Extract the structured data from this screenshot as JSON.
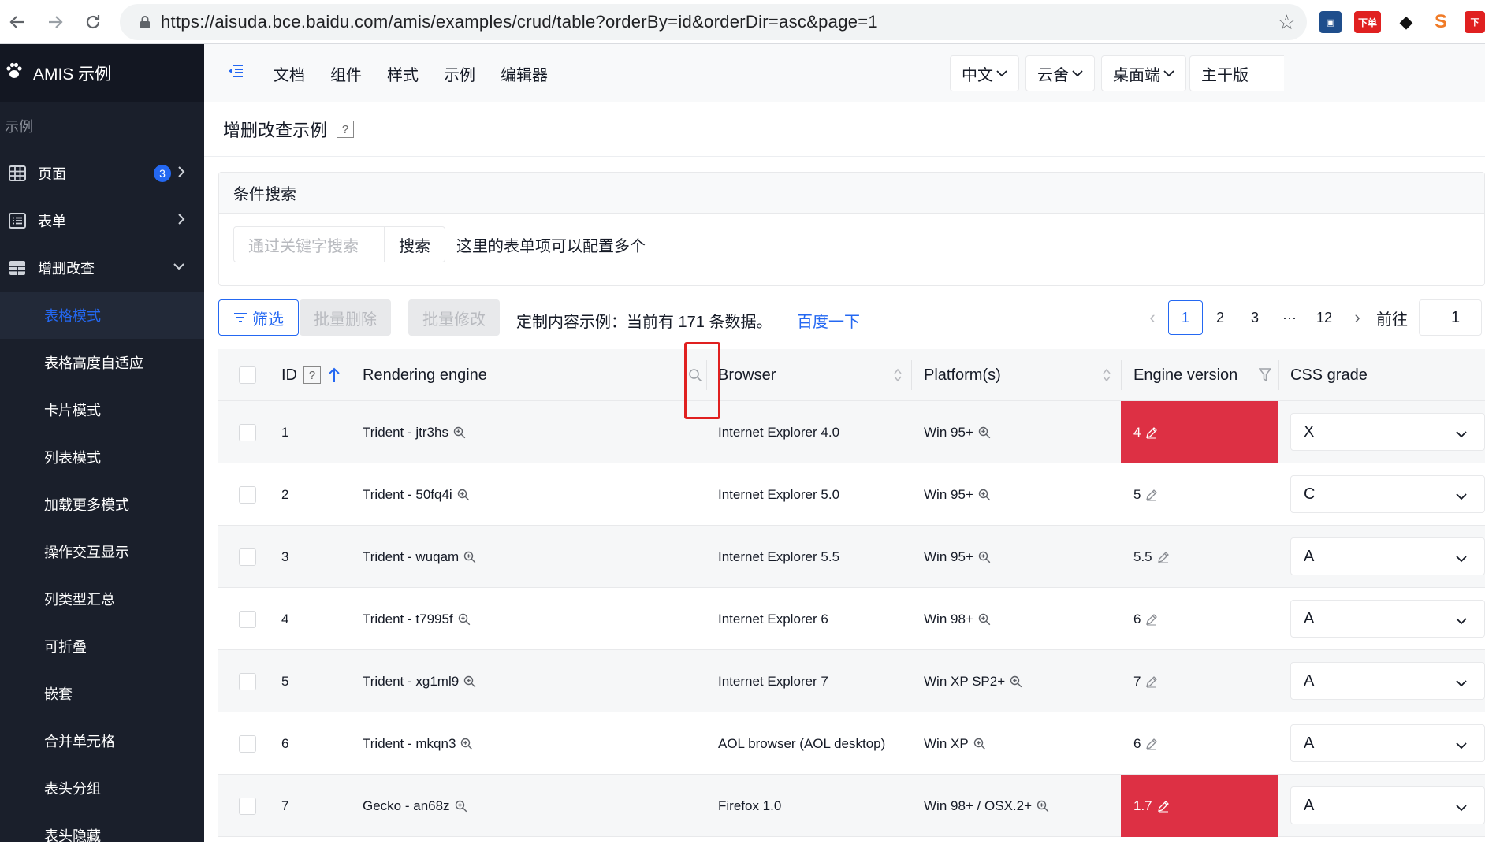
{
  "browser": {
    "url": "https://aisuda.bce.baidu.com/amis/examples/crud/table?orderBy=id&orderDir=asc&page=1",
    "ext_badge": "下单",
    "ext_badge2": "下"
  },
  "sidebar": {
    "brand": "AMIS 示例",
    "category": "示例",
    "items": [
      {
        "label": "页面",
        "badge": "3"
      },
      {
        "label": "表单"
      },
      {
        "label": "增删改查"
      }
    ],
    "sub_items": [
      "表格模式",
      "表格高度自适应",
      "卡片模式",
      "列表模式",
      "加载更多模式",
      "操作交互显示",
      "列类型汇总",
      "可折叠",
      "嵌套",
      "合并单元格",
      "表头分组",
      "表头隐藏"
    ]
  },
  "topnav": {
    "links": [
      "文档",
      "组件",
      "样式",
      "示例",
      "编辑器"
    ],
    "dropdowns": [
      "中文",
      "云舍",
      "桌面端",
      "主干版"
    ]
  },
  "page": {
    "title": "增删改查示例",
    "help": "?"
  },
  "search": {
    "panel_title": "条件搜索",
    "placeholder": "通过关键字搜索",
    "button": "搜索",
    "tip": "这里的表单项可以配置多个"
  },
  "toolbar": {
    "filter": "筛选",
    "bulk_delete": "批量删除",
    "bulk_edit": "批量修改",
    "info": "定制内容示例：当前有 171 条数据。",
    "link": "百度一下",
    "pages": [
      "1",
      "2",
      "3",
      "···",
      "12"
    ],
    "goto_label": "前往",
    "goto_value": "1"
  },
  "table": {
    "columns": [
      "ID",
      "Rendering engine",
      "Browser",
      "Platform(s)",
      "Engine version",
      "CSS grade"
    ],
    "id_help": "?",
    "rows": [
      {
        "id": "1",
        "engine": "Trident - jtr3hs",
        "browser": "Internet Explorer 4.0",
        "platform": "Win 95+",
        "version": "4",
        "grade": "X"
      },
      {
        "id": "2",
        "engine": "Trident - 50fq4i",
        "browser": "Internet Explorer 5.0",
        "platform": "Win 95+",
        "version": "5",
        "grade": "C"
      },
      {
        "id": "3",
        "engine": "Trident - wuqam",
        "browser": "Internet Explorer 5.5",
        "platform": "Win 95+",
        "version": "5.5",
        "grade": "A"
      },
      {
        "id": "4",
        "engine": "Trident - t7995f",
        "browser": "Internet Explorer 6",
        "platform": "Win 98+",
        "version": "6",
        "grade": "A"
      },
      {
        "id": "5",
        "engine": "Trident - xg1ml9",
        "browser": "Internet Explorer 7",
        "platform": "Win XP SP2+",
        "version": "7",
        "grade": "A"
      },
      {
        "id": "6",
        "engine": "Trident - mkqn3",
        "browser": "AOL browser (AOL desktop)",
        "platform": "Win XP",
        "version": "6",
        "grade": "A"
      },
      {
        "id": "7",
        "engine": "Gecko - an68z",
        "browser": "Firefox 1.0",
        "platform": "Win 98+ / OSX.2+",
        "version": "1.7",
        "grade": "A"
      }
    ]
  },
  "colors": {
    "primary": "#2468f2",
    "sidebar_bg": "#1a1f2b",
    "highlight": "#dd3044",
    "annotation": "#e02020"
  }
}
